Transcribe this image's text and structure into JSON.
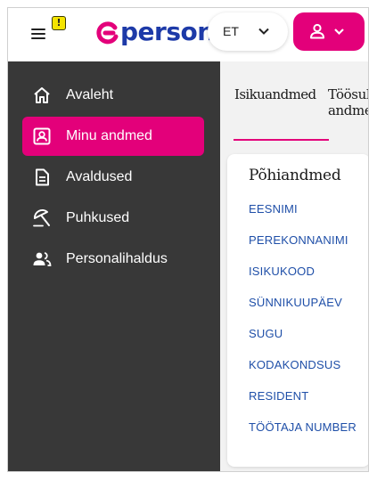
{
  "header": {
    "warning_badge": "!",
    "logo_text": "persona",
    "language": "ET",
    "colors": {
      "brand_pink": "#e3007a",
      "brand_blue": "#1d3aa8"
    }
  },
  "sidebar": {
    "items": [
      {
        "label": "Avaleht",
        "icon": "home-icon",
        "active": false
      },
      {
        "label": "Minu andmed",
        "icon": "profile-card-icon",
        "active": true
      },
      {
        "label": "Avaldused",
        "icon": "document-icon",
        "active": false
      },
      {
        "label": "Puhkused",
        "icon": "beach-umbrella-icon",
        "active": false
      },
      {
        "label": "Personalihaldus",
        "icon": "people-icon",
        "active": false
      }
    ]
  },
  "main": {
    "tabs": [
      {
        "label": "Isikuandmed",
        "active": true
      },
      {
        "label_line1": "Töösuh",
        "label_line2": "andme",
        "active": false
      }
    ],
    "card": {
      "title": "Põhiandmed",
      "fields": [
        "EESNIMI",
        "PEREKONNANIMI",
        "ISIKUKOOD",
        "SÜNNIKUUPÄEV",
        "SUGU",
        "KODAKONDSUS",
        "RESIDENT",
        "TÖÖTAJA NUMBER"
      ]
    }
  }
}
